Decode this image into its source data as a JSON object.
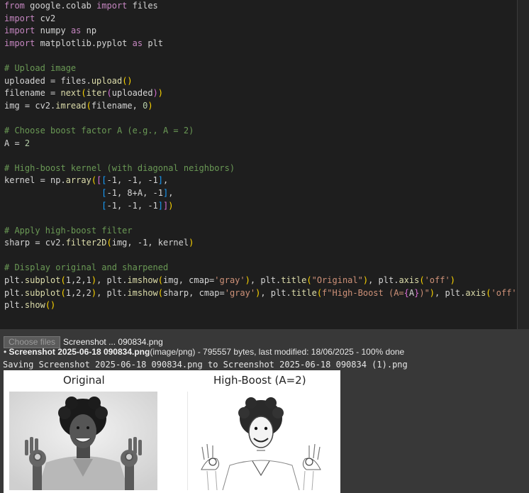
{
  "code_lines": [
    [
      {
        "c": "kw",
        "t": "from"
      },
      {
        "c": "tx",
        "t": " google.colab "
      },
      {
        "c": "kw",
        "t": "import"
      },
      {
        "c": "tx",
        "t": " files"
      }
    ],
    [
      {
        "c": "kw",
        "t": "import"
      },
      {
        "c": "tx",
        "t": " cv2"
      }
    ],
    [
      {
        "c": "kw",
        "t": "import"
      },
      {
        "c": "tx",
        "t": " numpy "
      },
      {
        "c": "kw",
        "t": "as"
      },
      {
        "c": "tx",
        "t": " np"
      }
    ],
    [
      {
        "c": "kw",
        "t": "import"
      },
      {
        "c": "tx",
        "t": " matplotlib.pyplot "
      },
      {
        "c": "kw",
        "t": "as"
      },
      {
        "c": "tx",
        "t": " plt"
      }
    ],
    [],
    [
      {
        "c": "cm",
        "t": "# Upload image"
      }
    ],
    [
      {
        "c": "tx",
        "t": "uploaded = files."
      },
      {
        "c": "fn",
        "t": "upload"
      },
      {
        "c": "p1",
        "t": "()"
      }
    ],
    [
      {
        "c": "tx",
        "t": "filename = "
      },
      {
        "c": "fn",
        "t": "next"
      },
      {
        "c": "p1",
        "t": "("
      },
      {
        "c": "fn",
        "t": "iter"
      },
      {
        "c": "p2",
        "t": "("
      },
      {
        "c": "tx",
        "t": "uploaded"
      },
      {
        "c": "p2",
        "t": ")"
      },
      {
        "c": "p1",
        "t": ")"
      }
    ],
    [
      {
        "c": "tx",
        "t": "img = cv2."
      },
      {
        "c": "fn",
        "t": "imread"
      },
      {
        "c": "p1",
        "t": "("
      },
      {
        "c": "tx",
        "t": "filename, "
      },
      {
        "c": "nu",
        "t": "0"
      },
      {
        "c": "p1",
        "t": ")"
      }
    ],
    [],
    [
      {
        "c": "cm",
        "t": "# Choose boost factor A (e.g., A = 2)"
      }
    ],
    [
      {
        "c": "tx",
        "t": "A = "
      },
      {
        "c": "nu",
        "t": "2"
      }
    ],
    [],
    [
      {
        "c": "cm",
        "t": "# High-boost kernel (with diagonal neighbors)"
      }
    ],
    [
      {
        "c": "tx",
        "t": "kernel = np."
      },
      {
        "c": "fn",
        "t": "array"
      },
      {
        "c": "p1",
        "t": "("
      },
      {
        "c": "p2",
        "t": "["
      },
      {
        "c": "p3",
        "t": "["
      },
      {
        "c": "tx",
        "t": "-1, -1, -1"
      },
      {
        "c": "p3",
        "t": "]"
      },
      {
        "c": "tx",
        "t": ","
      }
    ],
    [
      {
        "c": "tx",
        "t": "                   "
      },
      {
        "c": "p3",
        "t": "["
      },
      {
        "c": "tx",
        "t": "-1, 8+A, -1"
      },
      {
        "c": "p3",
        "t": "]"
      },
      {
        "c": "tx",
        "t": ","
      }
    ],
    [
      {
        "c": "tx",
        "t": "                   "
      },
      {
        "c": "p3",
        "t": "["
      },
      {
        "c": "tx",
        "t": "-1, -1, -1"
      },
      {
        "c": "p3",
        "t": "]"
      },
      {
        "c": "p2",
        "t": "]"
      },
      {
        "c": "p1",
        "t": ")"
      }
    ],
    [],
    [
      {
        "c": "cm",
        "t": "# Apply high-boost filter"
      }
    ],
    [
      {
        "c": "tx",
        "t": "sharp = cv2."
      },
      {
        "c": "fn",
        "t": "filter2D"
      },
      {
        "c": "p1",
        "t": "("
      },
      {
        "c": "tx",
        "t": "img, -1, kernel"
      },
      {
        "c": "p1",
        "t": ")"
      }
    ],
    [],
    [
      {
        "c": "cm",
        "t": "# Display original and sharpened"
      }
    ],
    [
      {
        "c": "tx",
        "t": "plt."
      },
      {
        "c": "fn",
        "t": "subplot"
      },
      {
        "c": "p1",
        "t": "("
      },
      {
        "c": "tx",
        "t": "1,2,1"
      },
      {
        "c": "p1",
        "t": ")"
      },
      {
        "c": "tx",
        "t": ", plt."
      },
      {
        "c": "fn",
        "t": "imshow"
      },
      {
        "c": "p1",
        "t": "("
      },
      {
        "c": "tx",
        "t": "img, cmap="
      },
      {
        "c": "st",
        "t": "'gray'"
      },
      {
        "c": "p1",
        "t": ")"
      },
      {
        "c": "tx",
        "t": ", plt."
      },
      {
        "c": "fn",
        "t": "title"
      },
      {
        "c": "p1",
        "t": "("
      },
      {
        "c": "st",
        "t": "\"Original\""
      },
      {
        "c": "p1",
        "t": ")"
      },
      {
        "c": "tx",
        "t": ", plt."
      },
      {
        "c": "fn",
        "t": "axis"
      },
      {
        "c": "p1",
        "t": "("
      },
      {
        "c": "st",
        "t": "'off'"
      },
      {
        "c": "p1",
        "t": ")"
      }
    ],
    [
      {
        "c": "tx",
        "t": "plt."
      },
      {
        "c": "fn",
        "t": "subplot"
      },
      {
        "c": "p1",
        "t": "("
      },
      {
        "c": "tx",
        "t": "1,2,2"
      },
      {
        "c": "p1",
        "t": ")"
      },
      {
        "c": "tx",
        "t": ", plt."
      },
      {
        "c": "fn",
        "t": "imshow"
      },
      {
        "c": "p1",
        "t": "("
      },
      {
        "c": "tx",
        "t": "sharp, cmap="
      },
      {
        "c": "st",
        "t": "'gray'"
      },
      {
        "c": "p1",
        "t": ")"
      },
      {
        "c": "tx",
        "t": ", plt."
      },
      {
        "c": "fn",
        "t": "title"
      },
      {
        "c": "p1",
        "t": "("
      },
      {
        "c": "st",
        "t": "f\"High-Boost (A="
      },
      {
        "c": "p2",
        "t": "{"
      },
      {
        "c": "tx",
        "t": "A"
      },
      {
        "c": "p2",
        "t": "}"
      },
      {
        "c": "st",
        "t": ")\""
      },
      {
        "c": "p1",
        "t": ")"
      },
      {
        "c": "tx",
        "t": ", plt."
      },
      {
        "c": "fn",
        "t": "axis"
      },
      {
        "c": "p1",
        "t": "("
      },
      {
        "c": "st",
        "t": "'off'"
      },
      {
        "c": "p1",
        "t": ")"
      }
    ],
    [
      {
        "c": "tx",
        "t": "plt."
      },
      {
        "c": "fn",
        "t": "show"
      },
      {
        "c": "p1",
        "t": "()"
      }
    ]
  ],
  "output": {
    "choose_files_label": "Choose files",
    "chosen_file": "Screenshot ... 090834.png",
    "bullet": "•",
    "upload_name": "Screenshot 2025-06-18 090834.png",
    "upload_meta": "(image/png) - 795557 bytes, last modified: 18/06/2025 - 100% done",
    "saving_line": "Saving Screenshot 2025-06-18 090834.png to Screenshot 2025-06-18 090834 (1).png"
  },
  "figure": {
    "title_left": "Original",
    "title_right": "High-Boost (A=2)"
  }
}
